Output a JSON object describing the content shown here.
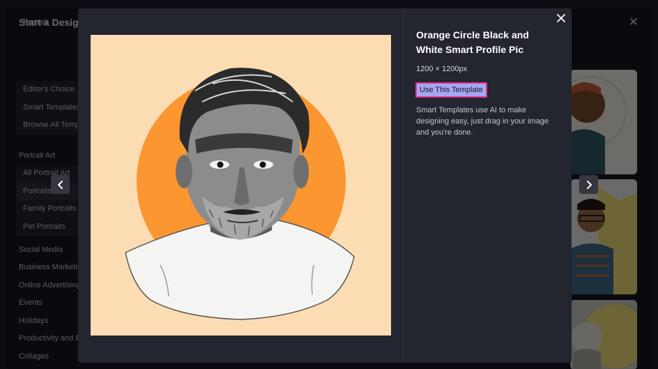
{
  "background": {
    "title": "Start a Design",
    "tab": "Portrait",
    "groups": [
      [
        "Editor's Choice",
        "Smart Templates",
        "Browse All Templates"
      ],
      [
        "All Portrait Art",
        "Portraits",
        "Family Portraits",
        "Pet Portraits"
      ]
    ],
    "section_portrait_art": "Portrait Art",
    "categories": [
      "Social Media",
      "Business Marketing",
      "Online Advertising",
      "Events",
      "Holidays",
      "Productivity and Education",
      "Collages"
    ]
  },
  "modal": {
    "title": "Orange Circle Black and White Smart Profile Pic",
    "dimensions": "1200 × 1200px",
    "use_button": "Use This Template",
    "description": "Smart Templates use AI to make designing easy, just drag in your image and you're done."
  },
  "colors": {
    "accent_button": "#a6a6f4",
    "button_border": "#e0358e",
    "preview_bg": "#fcdcb2",
    "orange_circle": "#fb9630"
  },
  "icons": [
    "close-icon",
    "chevron-left-icon",
    "chevron-right-icon"
  ]
}
